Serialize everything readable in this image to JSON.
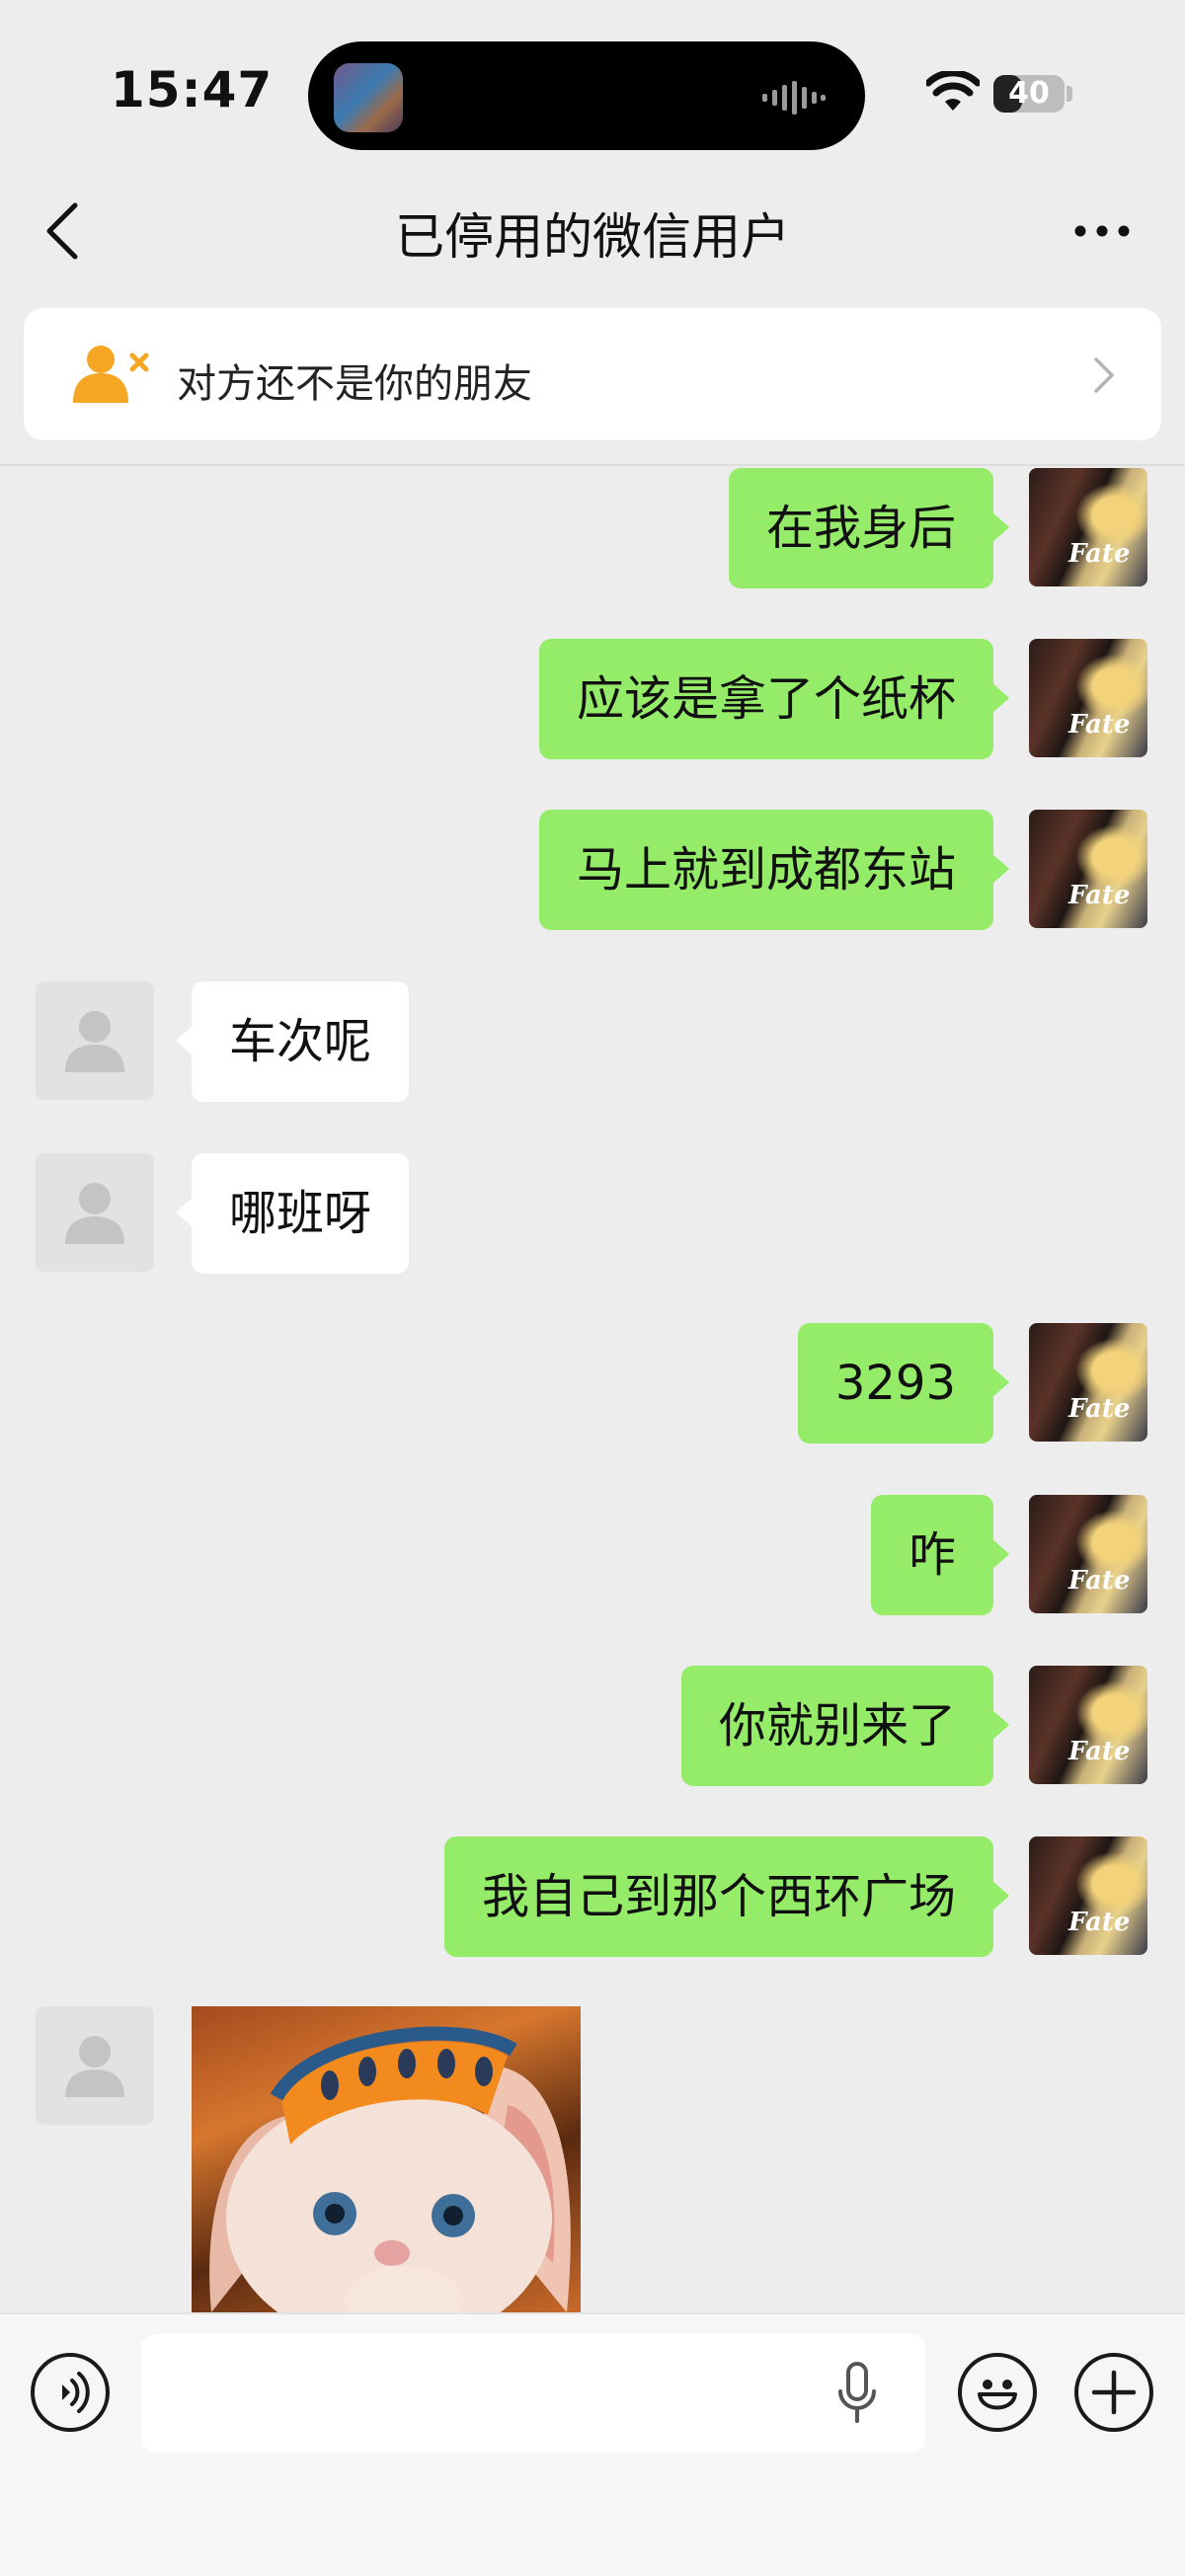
{
  "status_bar": {
    "time": "15:47",
    "battery": "40",
    "battery_level": 0.4
  },
  "header": {
    "title": "已停用的微信用户"
  },
  "banner": {
    "text": "对方还不是你的朋友"
  },
  "messages": [
    {
      "from": "me",
      "text": "在我身后"
    },
    {
      "from": "me",
      "text": "应该是拿了个纸杯"
    },
    {
      "from": "me",
      "text": "马上就到成都东站"
    },
    {
      "from": "other",
      "text": "车次呢"
    },
    {
      "from": "other",
      "text": "哪班呀"
    },
    {
      "from": "me",
      "text": "3293"
    },
    {
      "from": "me",
      "text": "咋"
    },
    {
      "from": "me",
      "text": "你就别来了"
    },
    {
      "from": "me",
      "text": "我自己到那个西环广场"
    },
    {
      "from": "other",
      "type": "sticker"
    }
  ],
  "my_avatar_text": "Fate",
  "input": {
    "value": "",
    "placeholder": ""
  },
  "icons": {
    "back": "chevron-left-icon",
    "more": "more-dots-icon",
    "banner": "add-friend-icon",
    "voice": "voice-mode-icon",
    "mic": "microphone-icon",
    "emoji": "emoji-icon",
    "plus": "plus-icon"
  },
  "colors": {
    "my_bubble": "#95ec69",
    "other_bubble": "#ffffff",
    "background": "#ededed",
    "banner_icon": "#f5a623"
  }
}
